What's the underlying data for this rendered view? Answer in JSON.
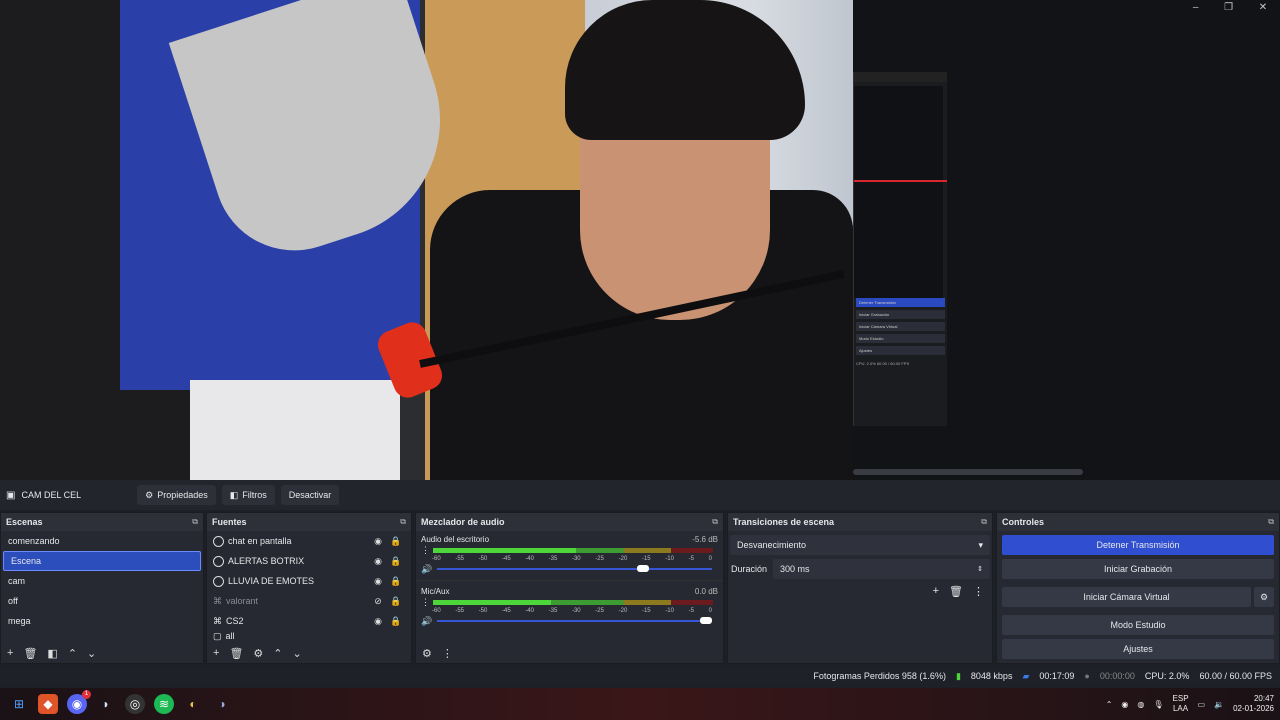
{
  "window_controls": [
    "–",
    "❐",
    "✕"
  ],
  "nested": {
    "buttons": [
      "Detener Transmisión",
      "Iniciar Grabación",
      "Iniciar Cámara Virtual",
      "Modo Estudio",
      "Ajustes"
    ],
    "status": "CPU: 2.0%   60.00 / 60.00 FPS",
    "clock": "20:47"
  },
  "toolbar": {
    "source_name": "CAM DEL CEL",
    "properties": "Propiedades",
    "filters": "Filtros",
    "deactivate": "Desactivar"
  },
  "scenes": {
    "title": "Escenas",
    "items": [
      "comenzando",
      "Escena",
      "cam",
      "off",
      "mega"
    ],
    "selected": "Escena"
  },
  "sources": {
    "title": "Fuentes",
    "items": [
      "chat en pantalla",
      "ALERTAS BOTRIX",
      "LLUVIA DE EMOTES",
      "valorant",
      "CS2",
      "all"
    ]
  },
  "mixer": {
    "title": "Mezclador de audio",
    "channels": [
      {
        "name": "Audio del escritorio",
        "db": "-5.6 dB",
        "level": 0.51,
        "volume": 0.77
      },
      {
        "name": "Mic/Aux",
        "db": "0.0 dB",
        "level": 0.42,
        "volume": 1.0
      }
    ],
    "ticks": [
      "-60",
      "-55",
      "-50",
      "-45",
      "-40",
      "-35",
      "-30",
      "-25",
      "-20",
      "-15",
      "-10",
      "-5",
      "0"
    ]
  },
  "transitions": {
    "title": "Transiciones de escena",
    "type": "Desvanecimiento",
    "duration_label": "Duración",
    "duration_value": "300 ms"
  },
  "controls": {
    "title": "Controles",
    "stop_stream": "Detener Transmisión",
    "start_record": "Iniciar Grabación",
    "virtual_cam": "Iniciar Cámara Virtual",
    "studio": "Modo Estudio",
    "settings": "Ajustes"
  },
  "status": {
    "dropped": "Fotogramas Perdidos 958 (1.6%)",
    "bitrate": "8048 kbps",
    "stream_time": "00:17:09",
    "rec_time": "00:00:00",
    "cpu": "CPU: 2.0%",
    "fps": "60.00 / 60.00 FPS"
  },
  "taskbar": {
    "lang1": "ESP",
    "lang2": "LAA",
    "time": "20:47",
    "date": "02-01-2026",
    "discord_badge": "1"
  }
}
